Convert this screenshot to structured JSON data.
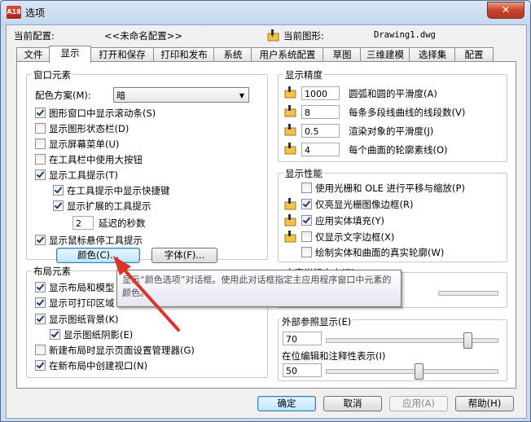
{
  "window": {
    "title": "选项",
    "app_icon": "A18",
    "close_glyph": "✕"
  },
  "profile": {
    "label": "当前配置:",
    "value": "<<未命名配置>>",
    "drawing_label": "当前图形:",
    "drawing_value": "Drawing1.dwg"
  },
  "tabs": [
    "文件",
    "显示",
    "打开和保存",
    "打印和发布",
    "系统",
    "用户系统配置",
    "草图",
    "三维建模",
    "选择集",
    "配置"
  ],
  "window_elements": {
    "title": "窗口元素",
    "color_scheme_label": "配色方案(M):",
    "color_scheme_value": "暗",
    "items": [
      {
        "label": "图形窗口中显示滚动条(S)",
        "checked": true
      },
      {
        "label": "显示图形状态栏(D)",
        "checked": false
      },
      {
        "label": "显示屏幕菜单(U)",
        "checked": false
      },
      {
        "label": "在工具栏中使用大按钮",
        "checked": false
      },
      {
        "label": "显示工具提示(T)",
        "checked": true
      },
      {
        "label": "在工具提示中显示快捷键",
        "checked": true
      },
      {
        "label": "显示扩展的工具提示",
        "checked": true
      },
      {
        "label": "显示鼠标悬停工具提示",
        "checked": true
      }
    ],
    "delay_value": "2",
    "delay_label": "延迟的秒数",
    "colors_button": "颜色(C)...",
    "fonts_button": "字体(F)..."
  },
  "layout_elements": {
    "title": "布局元素",
    "items": [
      {
        "label": "显示布局和模型",
        "checked": true
      },
      {
        "label": "显示可打印区域",
        "checked": true
      },
      {
        "label": "显示图纸背景(K)",
        "checked": true
      },
      {
        "label": "显示图纸阴影(E)",
        "checked": true
      },
      {
        "label": "新建布局时显示页面设置管理器(G)",
        "checked": false
      },
      {
        "label": "在新布局中创建视口(N)",
        "checked": true
      }
    ]
  },
  "display_resolution": {
    "title": "显示精度",
    "items": [
      {
        "value": "1000",
        "label": "圆弧和圆的平滑度(A)"
      },
      {
        "value": "8",
        "label": "每条多段线曲线的线段数(V)"
      },
      {
        "value": "0.5",
        "label": "渲染对象的平滑度(J)"
      },
      {
        "value": "4",
        "label": "每个曲面的轮廓素线(O)"
      }
    ]
  },
  "display_performance": {
    "title": "显示性能",
    "items": [
      {
        "label": "使用光栅和 OLE 进行平移与缩放(P)",
        "checked": false
      },
      {
        "label": "仅亮显光栅图像边框(R)",
        "checked": true
      },
      {
        "label": "应用实体填充(Y)",
        "checked": true
      },
      {
        "label": "仅显示文字边框(X)",
        "checked": false
      },
      {
        "label": "绘制实体和曲面的真实轮廓(W)",
        "checked": false
      }
    ]
  },
  "crosshair": {
    "title": "十字光标大小(Z)"
  },
  "fade": {
    "xref_label": "外部参照显示(E)",
    "xref_value": "70",
    "inplace_label": "在位编辑和注释性表示(I)",
    "inplace_value": "50"
  },
  "tooltip": {
    "text": "显示“颜色选项”对话框。使用此对话框指定主应用程序窗口中元素的颜色。"
  },
  "buttons": {
    "ok": "确定",
    "cancel": "取消",
    "apply": "应用(A)",
    "help": "帮助(H)"
  },
  "colors": {
    "accent": "#3c7fb1",
    "annotation_arrow": "#d9352b",
    "title_close": "#c7452c"
  }
}
